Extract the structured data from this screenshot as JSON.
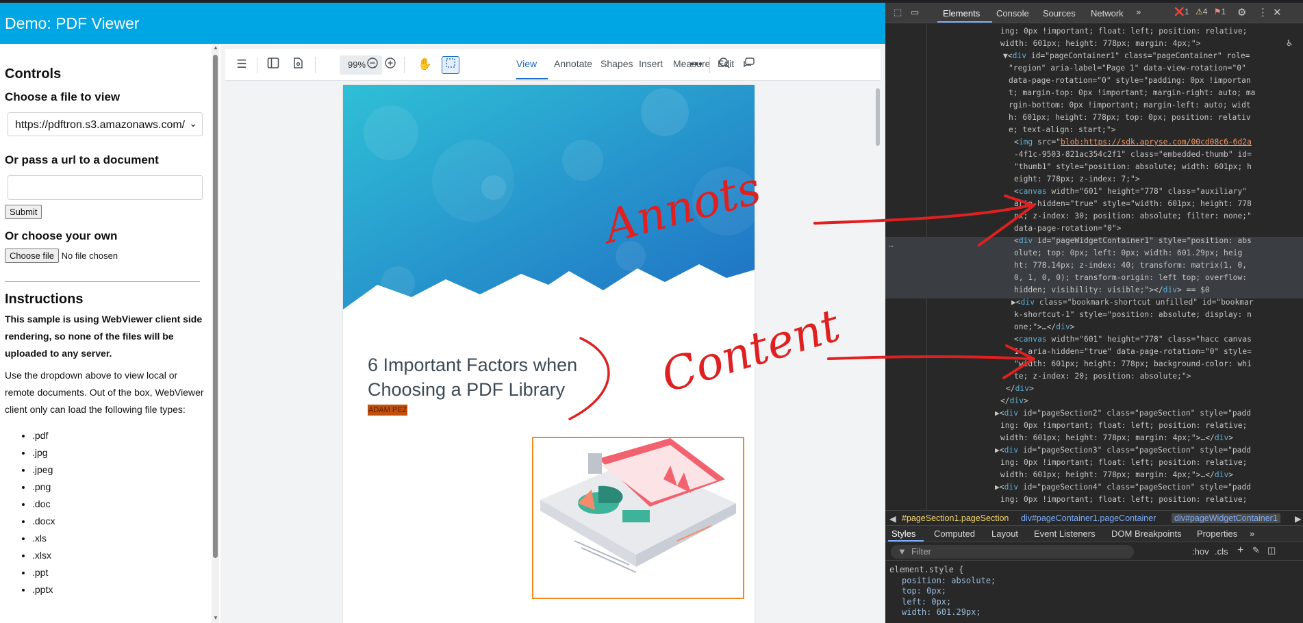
{
  "app": {
    "title": "Demo: PDF Viewer"
  },
  "side": {
    "controls_heading": "Controls",
    "choose_file_label": "Choose a file to view",
    "file_select_value": "https://pdftron.s3.amazonaws.com/",
    "url_label": "Or pass a url to a document",
    "url_value": "",
    "submit_label": "Submit",
    "own_label": "Or choose your own",
    "choose_file_button": "Choose file",
    "no_file_text": "No file chosen",
    "instructions_heading": "Instructions",
    "instructions_bold": "This sample is using WebViewer client side rendering, so none of the files will be uploaded to any server.",
    "instructions_text": "Use the dropdown above to view local or remote documents. Out of the box, WebViewer client only can load the following file types:",
    "file_types": [
      ".pdf",
      ".jpg",
      ".jpeg",
      ".png",
      ".doc",
      ".docx",
      ".xls",
      ".xlsx",
      ".ppt",
      ".pptx"
    ]
  },
  "viewer": {
    "zoom": "99%",
    "tabs": [
      "View",
      "Annotate",
      "Shapes",
      "Insert",
      "Measure",
      "Edit"
    ],
    "active_tab": "View",
    "icons": [
      "menu-icon",
      "sidebar-panel-icon",
      "file-icon",
      "zoom-out-icon",
      "zoom-in-icon",
      "pan-hand-icon",
      "select-marquee-icon",
      "more-icon",
      "search-icon",
      "comments-icon"
    ],
    "page": {
      "title": "6 Important Factors when Choosing a PDF Library",
      "author": "ADAM PEZ",
      "colors": {
        "header_gradient_start": "#29b3d6",
        "header_gradient_end": "#1f73c2",
        "illustration_border": "#f08a1c"
      }
    }
  },
  "annotations": {
    "annots_label": "Annots",
    "content_label": "Content",
    "color": "#e02020"
  },
  "devtools": {
    "tabs": [
      "Elements",
      "Console",
      "Sources",
      "Network"
    ],
    "active_tab": "Elements",
    "errors": "1",
    "warnings": "4",
    "issues": "1",
    "lines": [
      "ing: 0px !important; float: left; position: relative;",
      "width: 601px; height: 778px; margin: 4px;\">",
      "▼<div id=\"pageContainer1\" class=\"pageContainer\" role=",
      "\"region\" aria-label=\"Page 1\" data-view-rotation=\"0\"",
      "data-page-rotation=\"0\" style=\"padding: 0px !importan",
      "t; margin-top: 0px !important; margin-right: auto; ma",
      "rgin-bottom: 0px !important; margin-left: auto; widt",
      "h: 601px; height: 778px; top: 0px; position: relativ",
      "e; text-align: start;\">",
      "<img src=\"blob:https://sdk.apryse.com/00cd08c6-6d2a",
      "-4f1c-9503-821ac354c2f1\" class=\"embedded-thumb\" id=",
      "\"thumb1\" style=\"position: absolute; width: 601px; h",
      "eight: 778px; z-index: 7;\">",
      "<canvas width=\"601\" height=\"778\" class=\"auxiliary\"",
      "aria-hidden=\"true\" style=\"width: 601px; height: 778",
      "px; z-index: 30; position: absolute; filter: none;\"",
      "data-page-rotation=\"0\">",
      "<div id=\"pageWidgetContainer1\" style=\"position: abs",
      "olute; top: 0px; left: 0px; width: 601.29px; heig",
      "ht: 778.14px; z-index: 40; transform: matrix(1, 0,",
      "0, 1, 0, 0); transform-origin: left top; overflow:",
      "hidden; visibility: visible;\"></div> == $0",
      "▶<div class=\"bookmark-shortcut unfilled\" id=\"bookmar",
      "k-shortcut-1\" style=\"position: absolute; display: n",
      "one;\">…</div>",
      "<canvas width=\"601\" height=\"778\" class=\"hacc canvas",
      "1\" aria-hidden=\"true\" data-page-rotation=\"0\" style=",
      "\"width: 601px; height: 778px; background-color: whi",
      "te; z-index: 20; position: absolute;\">",
      "</div>",
      "</div>",
      "▶<div id=\"pageSection2\" class=\"pageSection\" style=\"padd",
      "ing: 0px !important; float: left; position: relative;",
      "width: 601px; height: 778px; margin: 4px;\">…</div>",
      "▶<div id=\"pageSection3\" class=\"pageSection\" style=\"padd",
      "ing: 0px !important; float: left; position: relative;",
      "width: 601px; height: 778px; margin: 4px;\">…</div>",
      "▶<div id=\"pageSection4\" class=\"pageSection\" style=\"padd",
      "ing: 0px !important; float: left; position: relative;"
    ],
    "breadcrumbs": [
      "#pageSection1.pageSection",
      "div#pageContainer1.pageContainer",
      "div#pageWidgetContainer1"
    ],
    "sub_tabs": [
      "Styles",
      "Computed",
      "Layout",
      "Event Listeners",
      "DOM Breakpoints",
      "Properties"
    ],
    "filter_placeholder": "Filter",
    "filter_tools": [
      ":hov",
      ".cls"
    ],
    "styles_selector": "element.style {",
    "styles_props": [
      "position: absolute;",
      "top: 0px;",
      "left: 0px;",
      "width: 601.29px;"
    ]
  }
}
